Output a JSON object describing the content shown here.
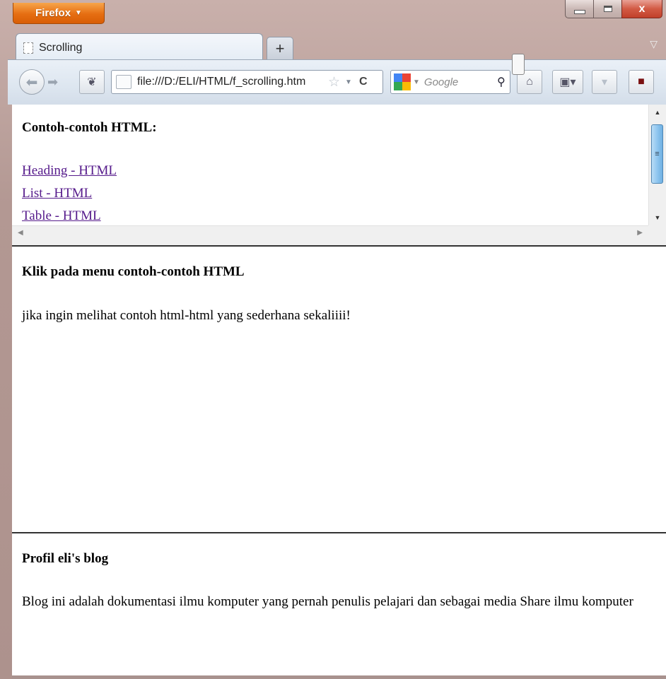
{
  "browser": {
    "menu_label": "Firefox",
    "close_glyph": "x",
    "tab_title": "Scrolling",
    "new_tab": "+",
    "url": "file:///D:/ELI/HTML/f_scrolling.htm",
    "search_placeholder": "Google"
  },
  "frame_top": {
    "heading": "Contoh-contoh HTML:",
    "links": [
      "Heading - HTML",
      "List - HTML",
      "Table - HTML"
    ]
  },
  "frame_middle": {
    "heading": "Klik pada menu contoh-contoh HTML",
    "text": "jika ingin melihat contoh html-html yang sederhana sekaliiii!"
  },
  "frame_bottom": {
    "heading": "Profil eli's blog",
    "text": "Blog ini adalah dokumentasi ilmu komputer yang pernah penulis pelajari dan sebagai media Share ilmu komputer"
  },
  "icons": [
    "firefox-menu-icon",
    "minimize-icon",
    "maximize-icon",
    "close-icon",
    "page-icon",
    "new-tab-icon",
    "back-icon",
    "forward-icon",
    "identity-icon",
    "bookmark-star-icon",
    "reload-icon",
    "google-icon",
    "search-icon",
    "home-icon",
    "bookmarks-icon",
    "downloads-icon",
    "addon-icon"
  ]
}
